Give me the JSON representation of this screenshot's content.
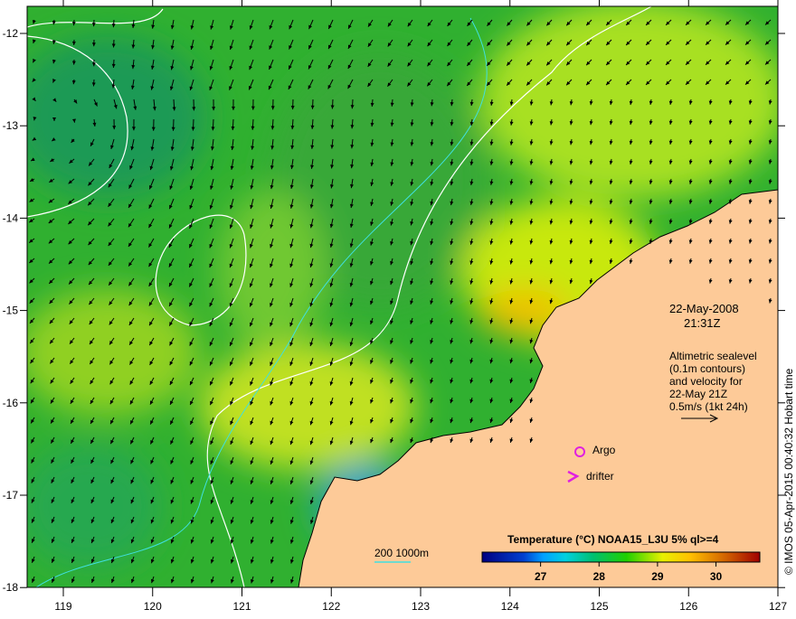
{
  "map": {
    "lon_ticks": [
      "119",
      "120",
      "121",
      "122",
      "123",
      "124",
      "125",
      "126",
      "127"
    ],
    "lat_ticks": [
      "-12",
      "-13",
      "-14",
      "-15",
      "-16",
      "-17",
      "-18"
    ],
    "date": "22-May-2008",
    "time": "21:31Z",
    "description": [
      "Altimetric sealevel",
      "(0.1m contours)",
      "and velocity for",
      "22-May 21Z",
      "0.5m/s (1kt 24h)"
    ],
    "legend_argo": "Argo",
    "legend_drifter": "drifter",
    "depth_legend": "200  1000m",
    "credit": "© IMOS 05-Apr-2015 00:40:32 Hobart time",
    "colorbar": {
      "title": "Temperature (°C) NOAA15_L3U 5% ql>=4",
      "ticks": [
        "27",
        "28",
        "29",
        "30"
      ],
      "range": [
        26.0,
        30.75
      ]
    },
    "colors": {
      "land": "#fdca98",
      "argo": "#e020e0",
      "contour": "#ffffff",
      "isobath": "#40e0e0"
    }
  }
}
